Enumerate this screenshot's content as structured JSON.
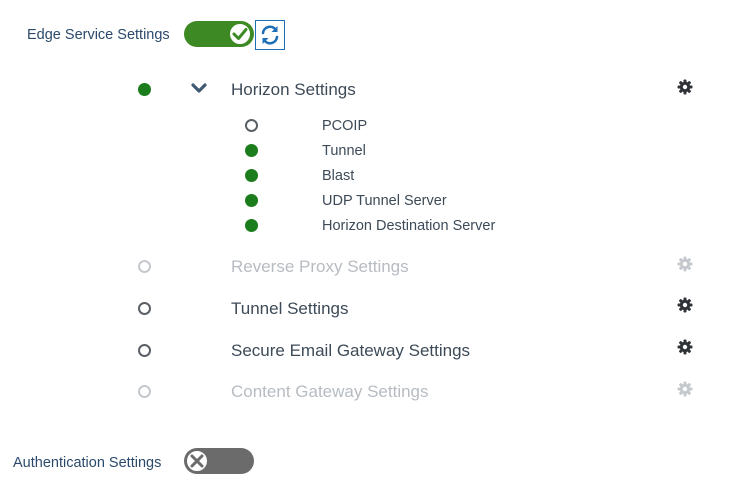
{
  "edge_service": {
    "label": "Edge Service Settings",
    "enabled": true
  },
  "groups": [
    {
      "title": "Horizon Settings",
      "status": "on",
      "expanded": true,
      "children": [
        {
          "label": "PCOIP",
          "status": "off"
        },
        {
          "label": "Tunnel",
          "status": "on"
        },
        {
          "label": "Blast",
          "status": "on"
        },
        {
          "label": "UDP Tunnel Server",
          "status": "on"
        },
        {
          "label": "Horizon Destination Server",
          "status": "on"
        }
      ]
    },
    {
      "title": "Reverse Proxy Settings",
      "status": "disabled"
    },
    {
      "title": "Tunnel Settings",
      "status": "off"
    },
    {
      "title": "Secure Email Gateway Settings",
      "status": "off"
    },
    {
      "title": "Content Gateway Settings",
      "status": "disabled"
    }
  ],
  "authentication": {
    "label": "Authentication Settings",
    "enabled": false
  },
  "colors": {
    "status_on": "#1c7d1c",
    "toggle_on": "#3d8a24",
    "toggle_off": "#6b6b6b",
    "accent_blue": "#1d6fb7",
    "label_blue": "#2b4a6b"
  },
  "icons": {
    "refresh": "refresh-icon",
    "gear": "gear-icon",
    "chevron": "chevron-down-icon",
    "check": "check-icon",
    "close": "close-icon"
  }
}
